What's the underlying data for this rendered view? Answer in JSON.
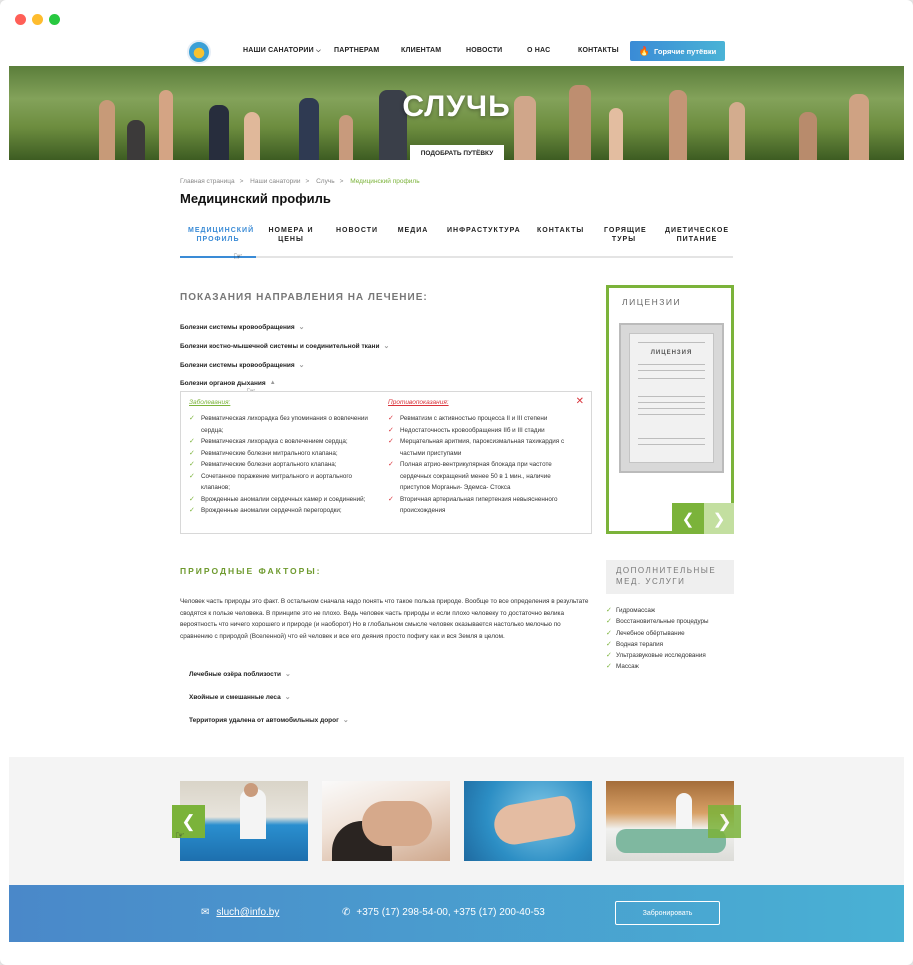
{
  "header": {
    "nav": [
      "НАШИ САНАТОРИИ",
      "ПАРТНЕРАМ",
      "КЛИЕНТАМ",
      "НОВОСТИ",
      "О НАС",
      "КОНТАКТЫ"
    ],
    "hot_button": "Горячие путёвки"
  },
  "hero": {
    "title": "СЛУЧЬ",
    "pick_button": "ПОДОБРАТЬ ПУТЁВКУ"
  },
  "breadcrumbs": [
    "Главная страница",
    "Наши санатории",
    "Случь",
    "Медицинский профиль"
  ],
  "page_title": "Медицинский профиль",
  "tabs": [
    "МЕДИЦИНСКИЙ ПРОФИЛЬ",
    "НОМЕРА И ЦЕНЫ",
    "НОВОСТИ",
    "МЕДИА",
    "ИНФРАСТУКТУРА",
    "КОНТАКТЫ",
    "ГОРЯЩИЕ ТУРЫ",
    "ДИЕТИЧЕСКОЕ ПИТАНИЕ"
  ],
  "indications": {
    "heading": "ПОКАЗАНИЯ НАПРАВЛЕНИЯ НА ЛЕЧЕНИЕ:",
    "items": [
      "Болезни системы кровообращения",
      "Болезни костно-мышечной системы и соединительной ткани",
      "Болезни системы кровообращения",
      "Болезни органов дыхания"
    ],
    "panel": {
      "diseases_label": "Заболевания:",
      "diseases": [
        "Ревматическая лихорадка без упоминания о вовлечении сердца;",
        "Ревматическая лихорадка с вовлечением сердца;",
        "Ревматические болезни митрального клапана;",
        "Ревматические болезни аортального клапана;",
        "Сочетанное поражение митрального и аортального клапанов;",
        "Врожденные аномалии сердечных камер и соединений;",
        "Врожденные аномалии сердечной перегородки;"
      ],
      "contra_label": "Противопоказания:",
      "contra": [
        "Ревматизм с активностью процесса II и III степени",
        "Недостаточность кровообращения IIб и III стадии",
        "Мерцательная аритмия, пароксизмальная тахикардия с частыми приступами",
        "Полная атрио-вентрикулярная блокада при частоте сердечных сокращений менее 50 в 1 мин., наличие приступов Морганьи- Эдемса- Стокса",
        "Вторичная артериальная гипертензия невыясненного происхождения"
      ]
    }
  },
  "natural": {
    "heading": "ПРИРОДНЫЕ ФАКТОРЫ:",
    "text": "Человек часть природы это факт. В остальном сначала надо понять что такое польза природе. Вообще то все определения в результате сводятся к пользе человека. В принципе это не плохо. Ведь человек часть природы и если плохо человеку то достаточно велика вероятность что ничего хорошего и природе (и наоборот) Но в глобальном смысле человек оказывается настолько мелочью по сравнению с природой (Вселенной) что ей человек и все его деяния просто пофигу как и вся Земля в целом.",
    "items": [
      "Лечебные озёра поблизости",
      "Хвойные и смешанные леса",
      "Территория удалена от автомобильных дорог"
    ]
  },
  "sidebar": {
    "licenses_heading": "ЛИЦЕНЗИИ",
    "license_doc_title": "ЛИЦЕНЗИЯ",
    "extra_heading": "ДОПОЛНИТЕЛЬНЫЕ МЕД. УСЛУГИ",
    "extra_items": [
      "Гидромассаж",
      "Восстановительные процедуры",
      "Лечебное обёртывание",
      "Водная терапия",
      "Ультразвуковые исследования",
      "Массаж"
    ]
  },
  "footer": {
    "email": "sluch@info.by",
    "phone": "+375 (17) 298-54-00,  +375 (17) 200-40-53",
    "book_button": "Забронировать"
  },
  "colors": {
    "accent_green": "#7bb33a",
    "accent_blue": "#3a8bd6",
    "alert_red": "#d9323a"
  }
}
